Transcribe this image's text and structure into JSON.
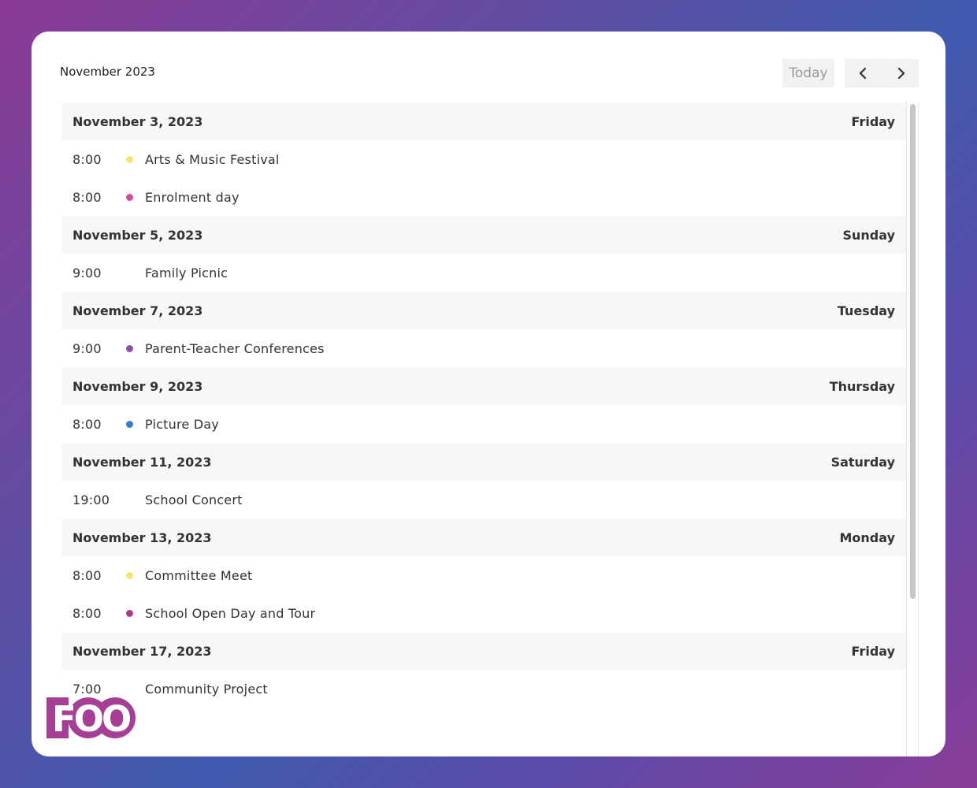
{
  "header": {
    "month_title": "November 2023",
    "today_label": "Today",
    "prev_icon": "chevron-left-icon",
    "next_icon": "chevron-right-icon"
  },
  "colors": {
    "yellow": "#f7e27a",
    "pink": "#d64a9a",
    "purple": "#8a4fae",
    "blue": "#2f7fd0",
    "magenta": "#b23a8c",
    "logo": "#a53f95"
  },
  "days": [
    {
      "date": "November 3, 2023",
      "weekday": "Friday",
      "events": [
        {
          "time": "8:00",
          "title": "Arts & Music Festival",
          "dot": "#f7e27a"
        },
        {
          "time": "8:00",
          "title": "Enrolment day",
          "dot": "#d64a9a"
        }
      ]
    },
    {
      "date": "November 5, 2023",
      "weekday": "Sunday",
      "events": [
        {
          "time": "9:00",
          "title": "Family Picnic",
          "dot": ""
        }
      ]
    },
    {
      "date": "November 7, 2023",
      "weekday": "Tuesday",
      "events": [
        {
          "time": "9:00",
          "title": "Parent-Teacher Conferences",
          "dot": "#8a4fae"
        }
      ]
    },
    {
      "date": "November 9, 2023",
      "weekday": "Thursday",
      "events": [
        {
          "time": "8:00",
          "title": "Picture Day",
          "dot": "#2f7fd0"
        }
      ]
    },
    {
      "date": "November 11, 2023",
      "weekday": "Saturday",
      "events": [
        {
          "time": "19:00",
          "title": "School Concert",
          "dot": ""
        }
      ]
    },
    {
      "date": "November 13, 2023",
      "weekday": "Monday",
      "events": [
        {
          "time": "8:00",
          "title": "Committee Meet",
          "dot": "#f7e27a"
        },
        {
          "time": "8:00",
          "title": "School Open Day and Tour",
          "dot": "#b23a8c"
        }
      ]
    },
    {
      "date": "November 17, 2023",
      "weekday": "Friday",
      "events": [
        {
          "time": "7:00",
          "title": "Community Project",
          "dot": ""
        }
      ]
    }
  ],
  "logo": {
    "text": "FOO"
  }
}
